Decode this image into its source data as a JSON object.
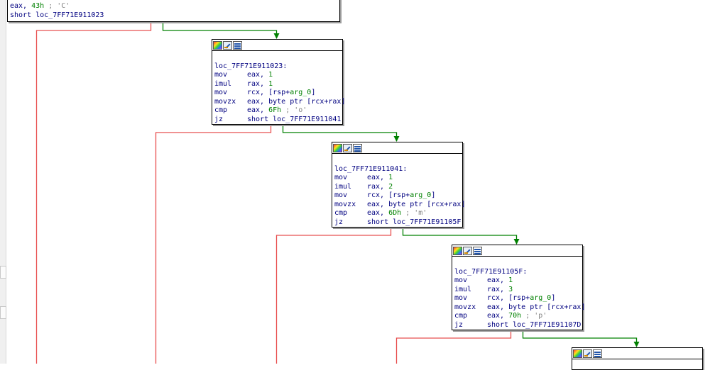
{
  "top_block": {
    "lines": [
      {
        "op": "eax, ",
        "num": "43h",
        "cmt": " ; 'C'"
      },
      {
        "op": "short loc_7FF71E911023"
      }
    ]
  },
  "blocks": [
    {
      "label": "loc_7FF71E911023:",
      "instructions": [
        {
          "mn": "mov",
          "op": "eax, ",
          "num": "1"
        },
        {
          "mn": "imul",
          "op": "rax, ",
          "num": "1"
        },
        {
          "mn": "mov",
          "op": "rcx, [rsp+",
          "ref": "arg_0",
          "post": "]"
        },
        {
          "mn": "movzx",
          "op": "eax, byte ptr [rcx+rax]"
        },
        {
          "mn": "cmp",
          "op": "eax, ",
          "num": "6Fh",
          "cmt": " ; 'o'"
        },
        {
          "mn": "jz",
          "op": "short loc_7FF71E911041"
        }
      ]
    },
    {
      "label": "loc_7FF71E911041:",
      "instructions": [
        {
          "mn": "mov",
          "op": "eax, ",
          "num": "1"
        },
        {
          "mn": "imul",
          "op": "rax, ",
          "num": "2"
        },
        {
          "mn": "mov",
          "op": "rcx, [rsp+",
          "ref": "arg_0",
          "post": "]"
        },
        {
          "mn": "movzx",
          "op": "eax, byte ptr [rcx+rax]"
        },
        {
          "mn": "cmp",
          "op": "eax, ",
          "num": "6Dh",
          "cmt": " ; 'm'"
        },
        {
          "mn": "jz",
          "op": "short loc_7FF71E91105F"
        }
      ]
    },
    {
      "label": "loc_7FF71E91105F:",
      "instructions": [
        {
          "mn": "mov",
          "op": "eax, ",
          "num": "1"
        },
        {
          "mn": "imul",
          "op": "rax, ",
          "num": "3"
        },
        {
          "mn": "mov",
          "op": "rcx, [rsp+",
          "ref": "arg_0",
          "post": "]"
        },
        {
          "mn": "movzx",
          "op": "eax, byte ptr [rcx+rax]"
        },
        {
          "mn": "cmp",
          "op": "eax, ",
          "num": "70h",
          "cmt": " ; 'p'"
        },
        {
          "mn": "jz",
          "op": "short loc_7FF71E91107D"
        }
      ]
    }
  ],
  "colors": {
    "true_edge": "#008000",
    "false_edge": "#e85050",
    "text": "#000080",
    "immediate": "#008000",
    "comment": "#808080"
  },
  "icons": [
    "color-picker-icon",
    "edit-node-icon",
    "graph-node-icon"
  ]
}
